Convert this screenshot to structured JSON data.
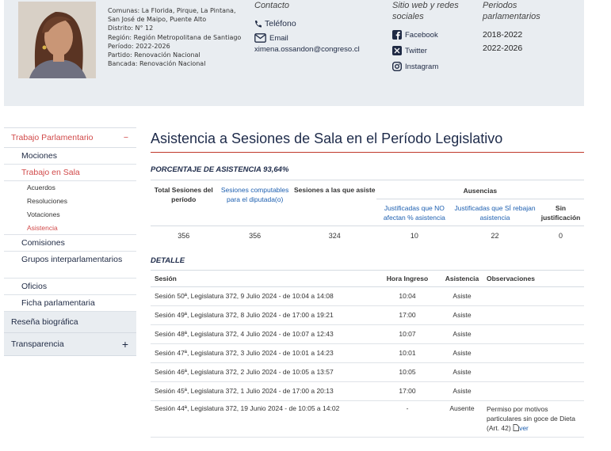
{
  "profile": {
    "comunas": "Comunas: La Florida, Pirque, La Pintana, San José de Maipo, Puente Alto",
    "distrito": "Distrito: N° 12",
    "region": "Región: Región Metropolitana de Santiago",
    "periodo": "Período: 2022-2026",
    "partido": "Partido: Renovación Nacional",
    "bancada": "Bancada: Renovación Nacional"
  },
  "contact": {
    "title": "Contacto",
    "phone_label": "Teléfono",
    "email_label": "Email",
    "email": "ximena.ossandon@congreso.cl"
  },
  "social": {
    "title": "Sitio web y redes sociales",
    "links": [
      "Facebook",
      "Twitter",
      "Instagram"
    ]
  },
  "periods": {
    "title": "Periodos parlamentarios",
    "items": [
      "2018-2022",
      "2022-2026"
    ]
  },
  "sidebar": {
    "trabajo": "Trabajo Parlamentario",
    "trabajo_toggle": "−",
    "mociones": "Mociones",
    "sala": "Trabajo en Sala",
    "acuerdos": "Acuerdos",
    "resoluciones": "Resoluciones",
    "votaciones": "Votaciones",
    "asistencia": "Asistencia",
    "comisiones": "Comisiones",
    "grupos": "Grupos interparlamentarios",
    "oficios": "Oficios",
    "ficha": "Ficha parlamentaria",
    "resena": "Reseña biográfica",
    "transparencia": "Transparencia",
    "transparencia_toggle": "+"
  },
  "main": {
    "title": "Asistencia a Sesiones de Sala en el Período Legislativo",
    "percentage": "PORCENTAJE DE ASISTENCIA 93,64%",
    "summary": {
      "total_label": "Total Sesiones del período",
      "computables_label": "Sesiones computables para el diputada(o)",
      "asiste_label": "Sesiones a las que asiste",
      "ausencias_label": "Ausencias",
      "just_no_label": "Justificadas que NO afectan % asistencia",
      "just_si_label": "Justificadas que SÍ rebajan asistencia",
      "sin_label": "Sin justificación",
      "total": "356",
      "computables": "356",
      "asiste": "324",
      "just_no": "10",
      "just_si": "22",
      "sin": "0"
    },
    "detail_title": "DETALLE",
    "detail_headers": {
      "sesion": "Sesión",
      "hora": "Hora Ingreso",
      "asistencia": "Asistencia",
      "observaciones": "Observaciones"
    },
    "rows": [
      {
        "sesion": "Sesión 50ª, Legislatura 372, 9 Julio 2024 - de 10:04 a 14:08",
        "hora": "10:04",
        "asistencia": "Asiste",
        "obs": ""
      },
      {
        "sesion": "Sesión 49ª, Legislatura 372, 8 Julio 2024 - de 17:00 a 19:21",
        "hora": "17:00",
        "asistencia": "Asiste",
        "obs": ""
      },
      {
        "sesion": "Sesión 48ª, Legislatura 372, 4 Julio 2024 - de 10:07 a 12:43",
        "hora": "10:07",
        "asistencia": "Asiste",
        "obs": ""
      },
      {
        "sesion": "Sesión 47ª, Legislatura 372, 3 Julio 2024 - de 10:01 a 14:23",
        "hora": "10:01",
        "asistencia": "Asiste",
        "obs": ""
      },
      {
        "sesion": "Sesión 46ª, Legislatura 372, 2 Julio 2024 - de 10:05 a 13:57",
        "hora": "10:05",
        "asistencia": "Asiste",
        "obs": ""
      },
      {
        "sesion": "Sesión 45ª, Legislatura 372, 1 Julio 2024 - de 17:00 a 20:13",
        "hora": "17:00",
        "asistencia": "Asiste",
        "obs": ""
      },
      {
        "sesion": "Sesión 44ª, Legislatura 372, 19 Junio 2024 - de 10:05 a 14:02",
        "hora": "-",
        "asistencia": "Ausente",
        "obs": "Permiso por motivos particulares sin goce de Dieta (Art. 42)",
        "ver": "ver"
      }
    ]
  }
}
